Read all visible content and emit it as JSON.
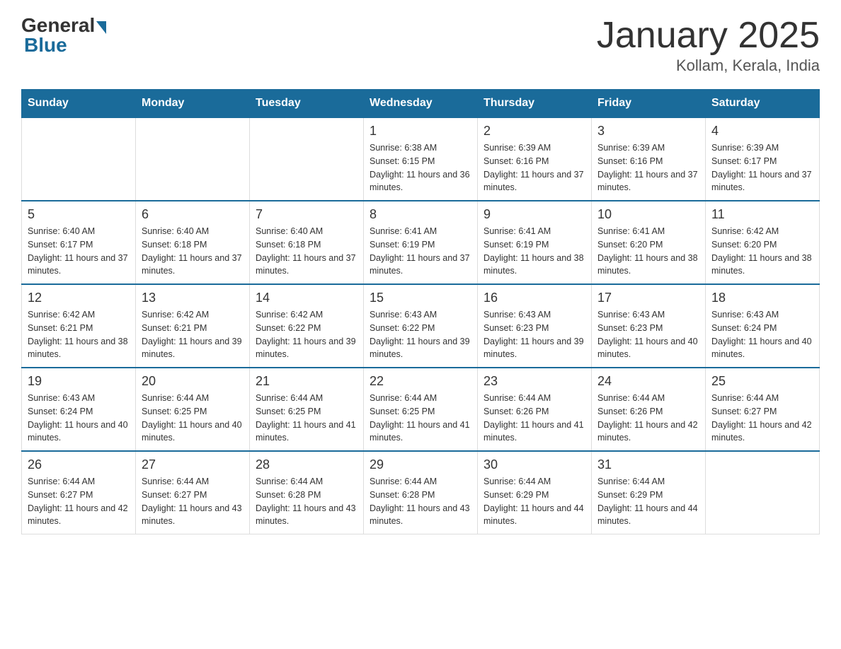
{
  "header": {
    "logo_general": "General",
    "logo_blue": "Blue",
    "title": "January 2025",
    "subtitle": "Kollam, Kerala, India"
  },
  "days_of_week": [
    "Sunday",
    "Monday",
    "Tuesday",
    "Wednesday",
    "Thursday",
    "Friday",
    "Saturday"
  ],
  "weeks": [
    {
      "days": [
        {
          "number": "",
          "info": ""
        },
        {
          "number": "",
          "info": ""
        },
        {
          "number": "",
          "info": ""
        },
        {
          "number": "1",
          "info": "Sunrise: 6:38 AM\nSunset: 6:15 PM\nDaylight: 11 hours and 36 minutes."
        },
        {
          "number": "2",
          "info": "Sunrise: 6:39 AM\nSunset: 6:16 PM\nDaylight: 11 hours and 37 minutes."
        },
        {
          "number": "3",
          "info": "Sunrise: 6:39 AM\nSunset: 6:16 PM\nDaylight: 11 hours and 37 minutes."
        },
        {
          "number": "4",
          "info": "Sunrise: 6:39 AM\nSunset: 6:17 PM\nDaylight: 11 hours and 37 minutes."
        }
      ]
    },
    {
      "days": [
        {
          "number": "5",
          "info": "Sunrise: 6:40 AM\nSunset: 6:17 PM\nDaylight: 11 hours and 37 minutes."
        },
        {
          "number": "6",
          "info": "Sunrise: 6:40 AM\nSunset: 6:18 PM\nDaylight: 11 hours and 37 minutes."
        },
        {
          "number": "7",
          "info": "Sunrise: 6:40 AM\nSunset: 6:18 PM\nDaylight: 11 hours and 37 minutes."
        },
        {
          "number": "8",
          "info": "Sunrise: 6:41 AM\nSunset: 6:19 PM\nDaylight: 11 hours and 37 minutes."
        },
        {
          "number": "9",
          "info": "Sunrise: 6:41 AM\nSunset: 6:19 PM\nDaylight: 11 hours and 38 minutes."
        },
        {
          "number": "10",
          "info": "Sunrise: 6:41 AM\nSunset: 6:20 PM\nDaylight: 11 hours and 38 minutes."
        },
        {
          "number": "11",
          "info": "Sunrise: 6:42 AM\nSunset: 6:20 PM\nDaylight: 11 hours and 38 minutes."
        }
      ]
    },
    {
      "days": [
        {
          "number": "12",
          "info": "Sunrise: 6:42 AM\nSunset: 6:21 PM\nDaylight: 11 hours and 38 minutes."
        },
        {
          "number": "13",
          "info": "Sunrise: 6:42 AM\nSunset: 6:21 PM\nDaylight: 11 hours and 39 minutes."
        },
        {
          "number": "14",
          "info": "Sunrise: 6:42 AM\nSunset: 6:22 PM\nDaylight: 11 hours and 39 minutes."
        },
        {
          "number": "15",
          "info": "Sunrise: 6:43 AM\nSunset: 6:22 PM\nDaylight: 11 hours and 39 minutes."
        },
        {
          "number": "16",
          "info": "Sunrise: 6:43 AM\nSunset: 6:23 PM\nDaylight: 11 hours and 39 minutes."
        },
        {
          "number": "17",
          "info": "Sunrise: 6:43 AM\nSunset: 6:23 PM\nDaylight: 11 hours and 40 minutes."
        },
        {
          "number": "18",
          "info": "Sunrise: 6:43 AM\nSunset: 6:24 PM\nDaylight: 11 hours and 40 minutes."
        }
      ]
    },
    {
      "days": [
        {
          "number": "19",
          "info": "Sunrise: 6:43 AM\nSunset: 6:24 PM\nDaylight: 11 hours and 40 minutes."
        },
        {
          "number": "20",
          "info": "Sunrise: 6:44 AM\nSunset: 6:25 PM\nDaylight: 11 hours and 40 minutes."
        },
        {
          "number": "21",
          "info": "Sunrise: 6:44 AM\nSunset: 6:25 PM\nDaylight: 11 hours and 41 minutes."
        },
        {
          "number": "22",
          "info": "Sunrise: 6:44 AM\nSunset: 6:25 PM\nDaylight: 11 hours and 41 minutes."
        },
        {
          "number": "23",
          "info": "Sunrise: 6:44 AM\nSunset: 6:26 PM\nDaylight: 11 hours and 41 minutes."
        },
        {
          "number": "24",
          "info": "Sunrise: 6:44 AM\nSunset: 6:26 PM\nDaylight: 11 hours and 42 minutes."
        },
        {
          "number": "25",
          "info": "Sunrise: 6:44 AM\nSunset: 6:27 PM\nDaylight: 11 hours and 42 minutes."
        }
      ]
    },
    {
      "days": [
        {
          "number": "26",
          "info": "Sunrise: 6:44 AM\nSunset: 6:27 PM\nDaylight: 11 hours and 42 minutes."
        },
        {
          "number": "27",
          "info": "Sunrise: 6:44 AM\nSunset: 6:27 PM\nDaylight: 11 hours and 43 minutes."
        },
        {
          "number": "28",
          "info": "Sunrise: 6:44 AM\nSunset: 6:28 PM\nDaylight: 11 hours and 43 minutes."
        },
        {
          "number": "29",
          "info": "Sunrise: 6:44 AM\nSunset: 6:28 PM\nDaylight: 11 hours and 43 minutes."
        },
        {
          "number": "30",
          "info": "Sunrise: 6:44 AM\nSunset: 6:29 PM\nDaylight: 11 hours and 44 minutes."
        },
        {
          "number": "31",
          "info": "Sunrise: 6:44 AM\nSunset: 6:29 PM\nDaylight: 11 hours and 44 minutes."
        },
        {
          "number": "",
          "info": ""
        }
      ]
    }
  ]
}
